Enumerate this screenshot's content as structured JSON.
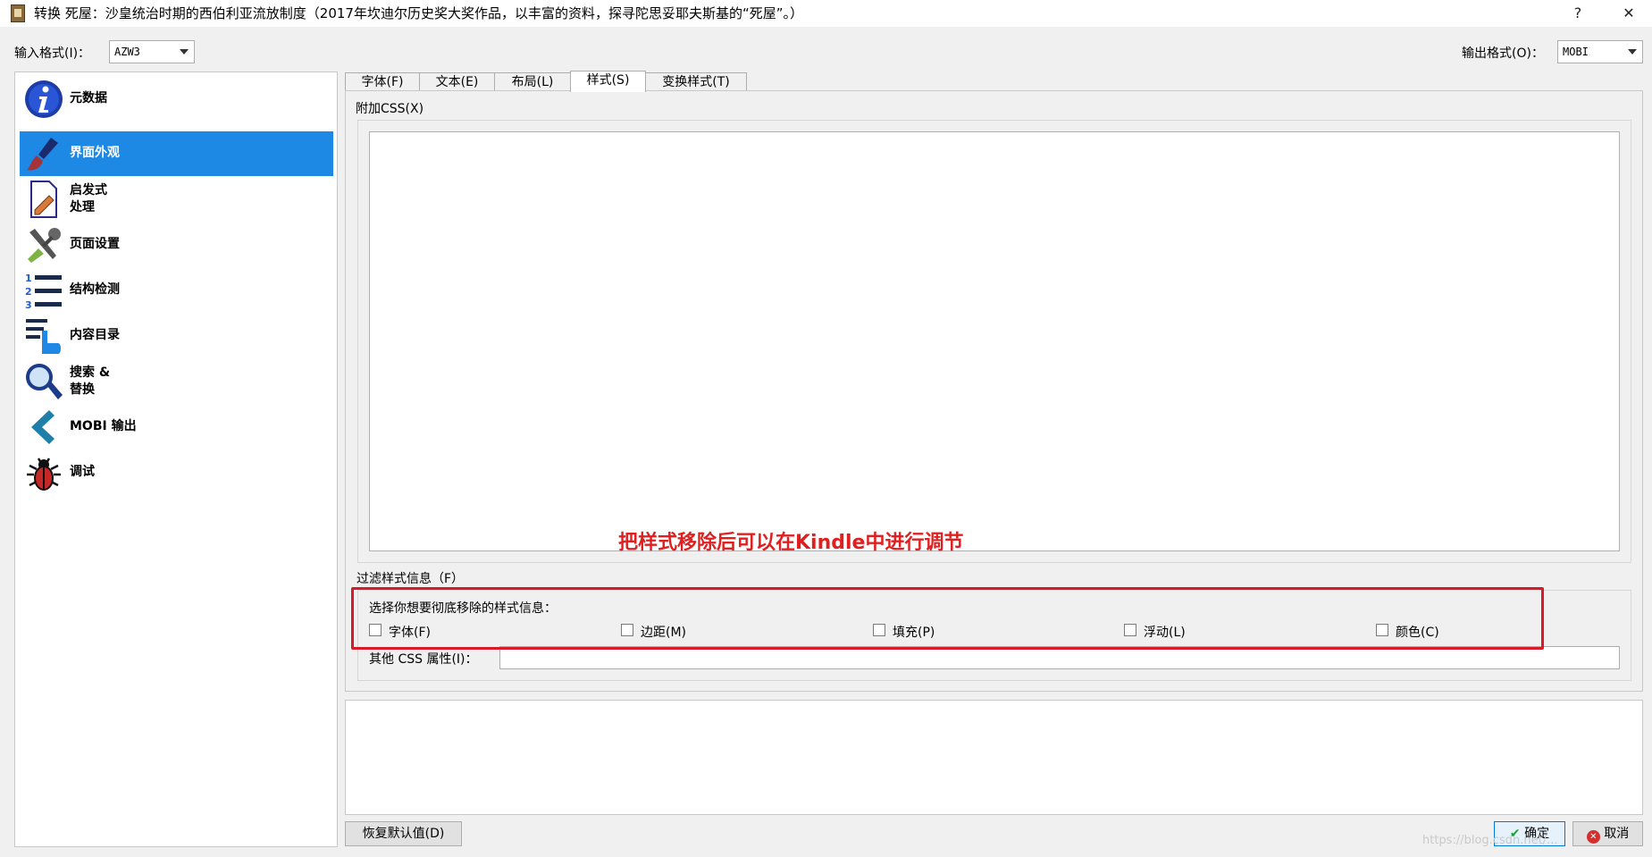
{
  "window": {
    "title": "转换 死屋：沙皇统治时期的西伯利亚流放制度（2017年坎迪尔历史奖大奖作品，以丰富的资料，探寻陀思妥耶夫斯基的“死屋”。）",
    "help_label": "?",
    "close_label": "✕"
  },
  "input_format": {
    "label": "输入格式(I)：",
    "value": "AZW3"
  },
  "output_format": {
    "label": "输出格式(O)：",
    "value": "MOBI"
  },
  "sidebar": {
    "items": [
      {
        "label": "元数据",
        "icon": "info-icon"
      },
      {
        "label": "界面外观",
        "icon": "paintbrush-icon",
        "active": true
      },
      {
        "label": "启发式\n处理",
        "icon": "document-pencil-icon"
      },
      {
        "label": "页面设置",
        "icon": "tools-icon"
      },
      {
        "label": "结构检测",
        "icon": "numbered-list-icon"
      },
      {
        "label": "内容目录",
        "icon": "toc-hand-icon"
      },
      {
        "label": "搜索 &\n替换",
        "icon": "magnifier-icon"
      },
      {
        "label": "MOBI 输出",
        "icon": "chevron-left-icon"
      },
      {
        "label": "调试",
        "icon": "bug-icon"
      }
    ]
  },
  "tabs": [
    {
      "label": "字体(F)"
    },
    {
      "label": "文本(E)"
    },
    {
      "label": "布局(L)"
    },
    {
      "label": "样式(S)",
      "active": true
    },
    {
      "label": "变换样式(T)"
    }
  ],
  "styles": {
    "extra_css_label": "附加CSS(X)",
    "extra_css_value": "",
    "filter_title": "过滤样式信息（F）",
    "filter_description": "选择你想要彻底移除的样式信息：",
    "checkboxes": [
      {
        "label": "字体(F)",
        "checked": false
      },
      {
        "label": "边距(M)",
        "checked": false
      },
      {
        "label": "填充(P)",
        "checked": false
      },
      {
        "label": "浮动(L)",
        "checked": false
      },
      {
        "label": "颜色(C)",
        "checked": false
      }
    ],
    "other_css_label": "其他 CSS 属性(I)：",
    "other_css_value": ""
  },
  "annotation": {
    "text": "把样式移除后可以在Kindle中进行调节",
    "color": "#e02020"
  },
  "buttons": {
    "restore_defaults": "恢复默认值(D)",
    "ok": "确定",
    "cancel": "取消"
  },
  "watermark": "https://blog.csdn.net/..."
}
